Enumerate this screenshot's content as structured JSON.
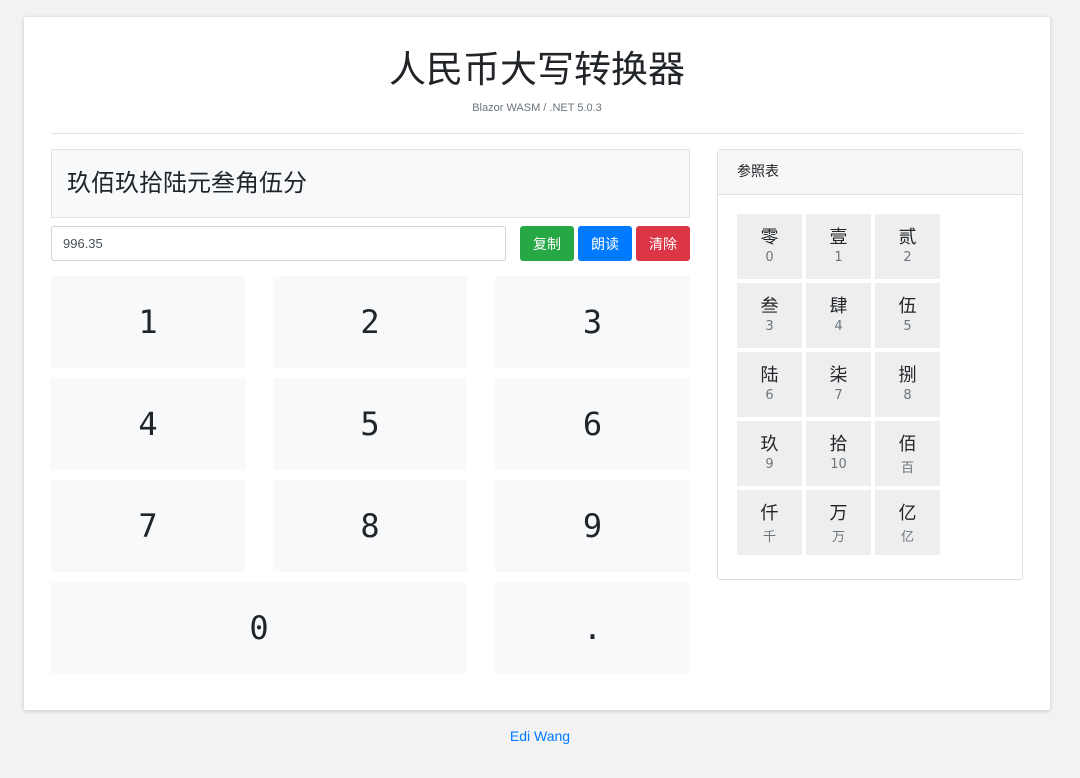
{
  "header": {
    "title": "人民币大写转换器",
    "subtitle": "Blazor WASM / .NET 5.0.3"
  },
  "result": {
    "text": "玖佰玖拾陆元叁角伍分"
  },
  "input": {
    "value": "996.35"
  },
  "buttons": {
    "copy": "复制",
    "read": "朗读",
    "clear": "清除"
  },
  "keypad": {
    "keys": [
      "1",
      "2",
      "3",
      "4",
      "5",
      "6",
      "7",
      "8",
      "9",
      "0",
      "."
    ]
  },
  "reference": {
    "title": "参照表",
    "items": [
      {
        "char": "零",
        "value": "0"
      },
      {
        "char": "壹",
        "value": "1"
      },
      {
        "char": "贰",
        "value": "2"
      },
      {
        "char": "叁",
        "value": "3"
      },
      {
        "char": "肆",
        "value": "4"
      },
      {
        "char": "伍",
        "value": "5"
      },
      {
        "char": "陆",
        "value": "6"
      },
      {
        "char": "柒",
        "value": "7"
      },
      {
        "char": "捌",
        "value": "8"
      },
      {
        "char": "玖",
        "value": "9"
      },
      {
        "char": "拾",
        "value": "10"
      },
      {
        "char": "佰",
        "value": "百"
      },
      {
        "char": "仟",
        "value": "千"
      },
      {
        "char": "万",
        "value": "万"
      },
      {
        "char": "亿",
        "value": "亿"
      }
    ]
  },
  "footer": {
    "link": "Edi Wang"
  },
  "colors": {
    "copy": "#28a745",
    "read": "#007bff",
    "clear": "#dc3545",
    "link": "#007bff"
  }
}
